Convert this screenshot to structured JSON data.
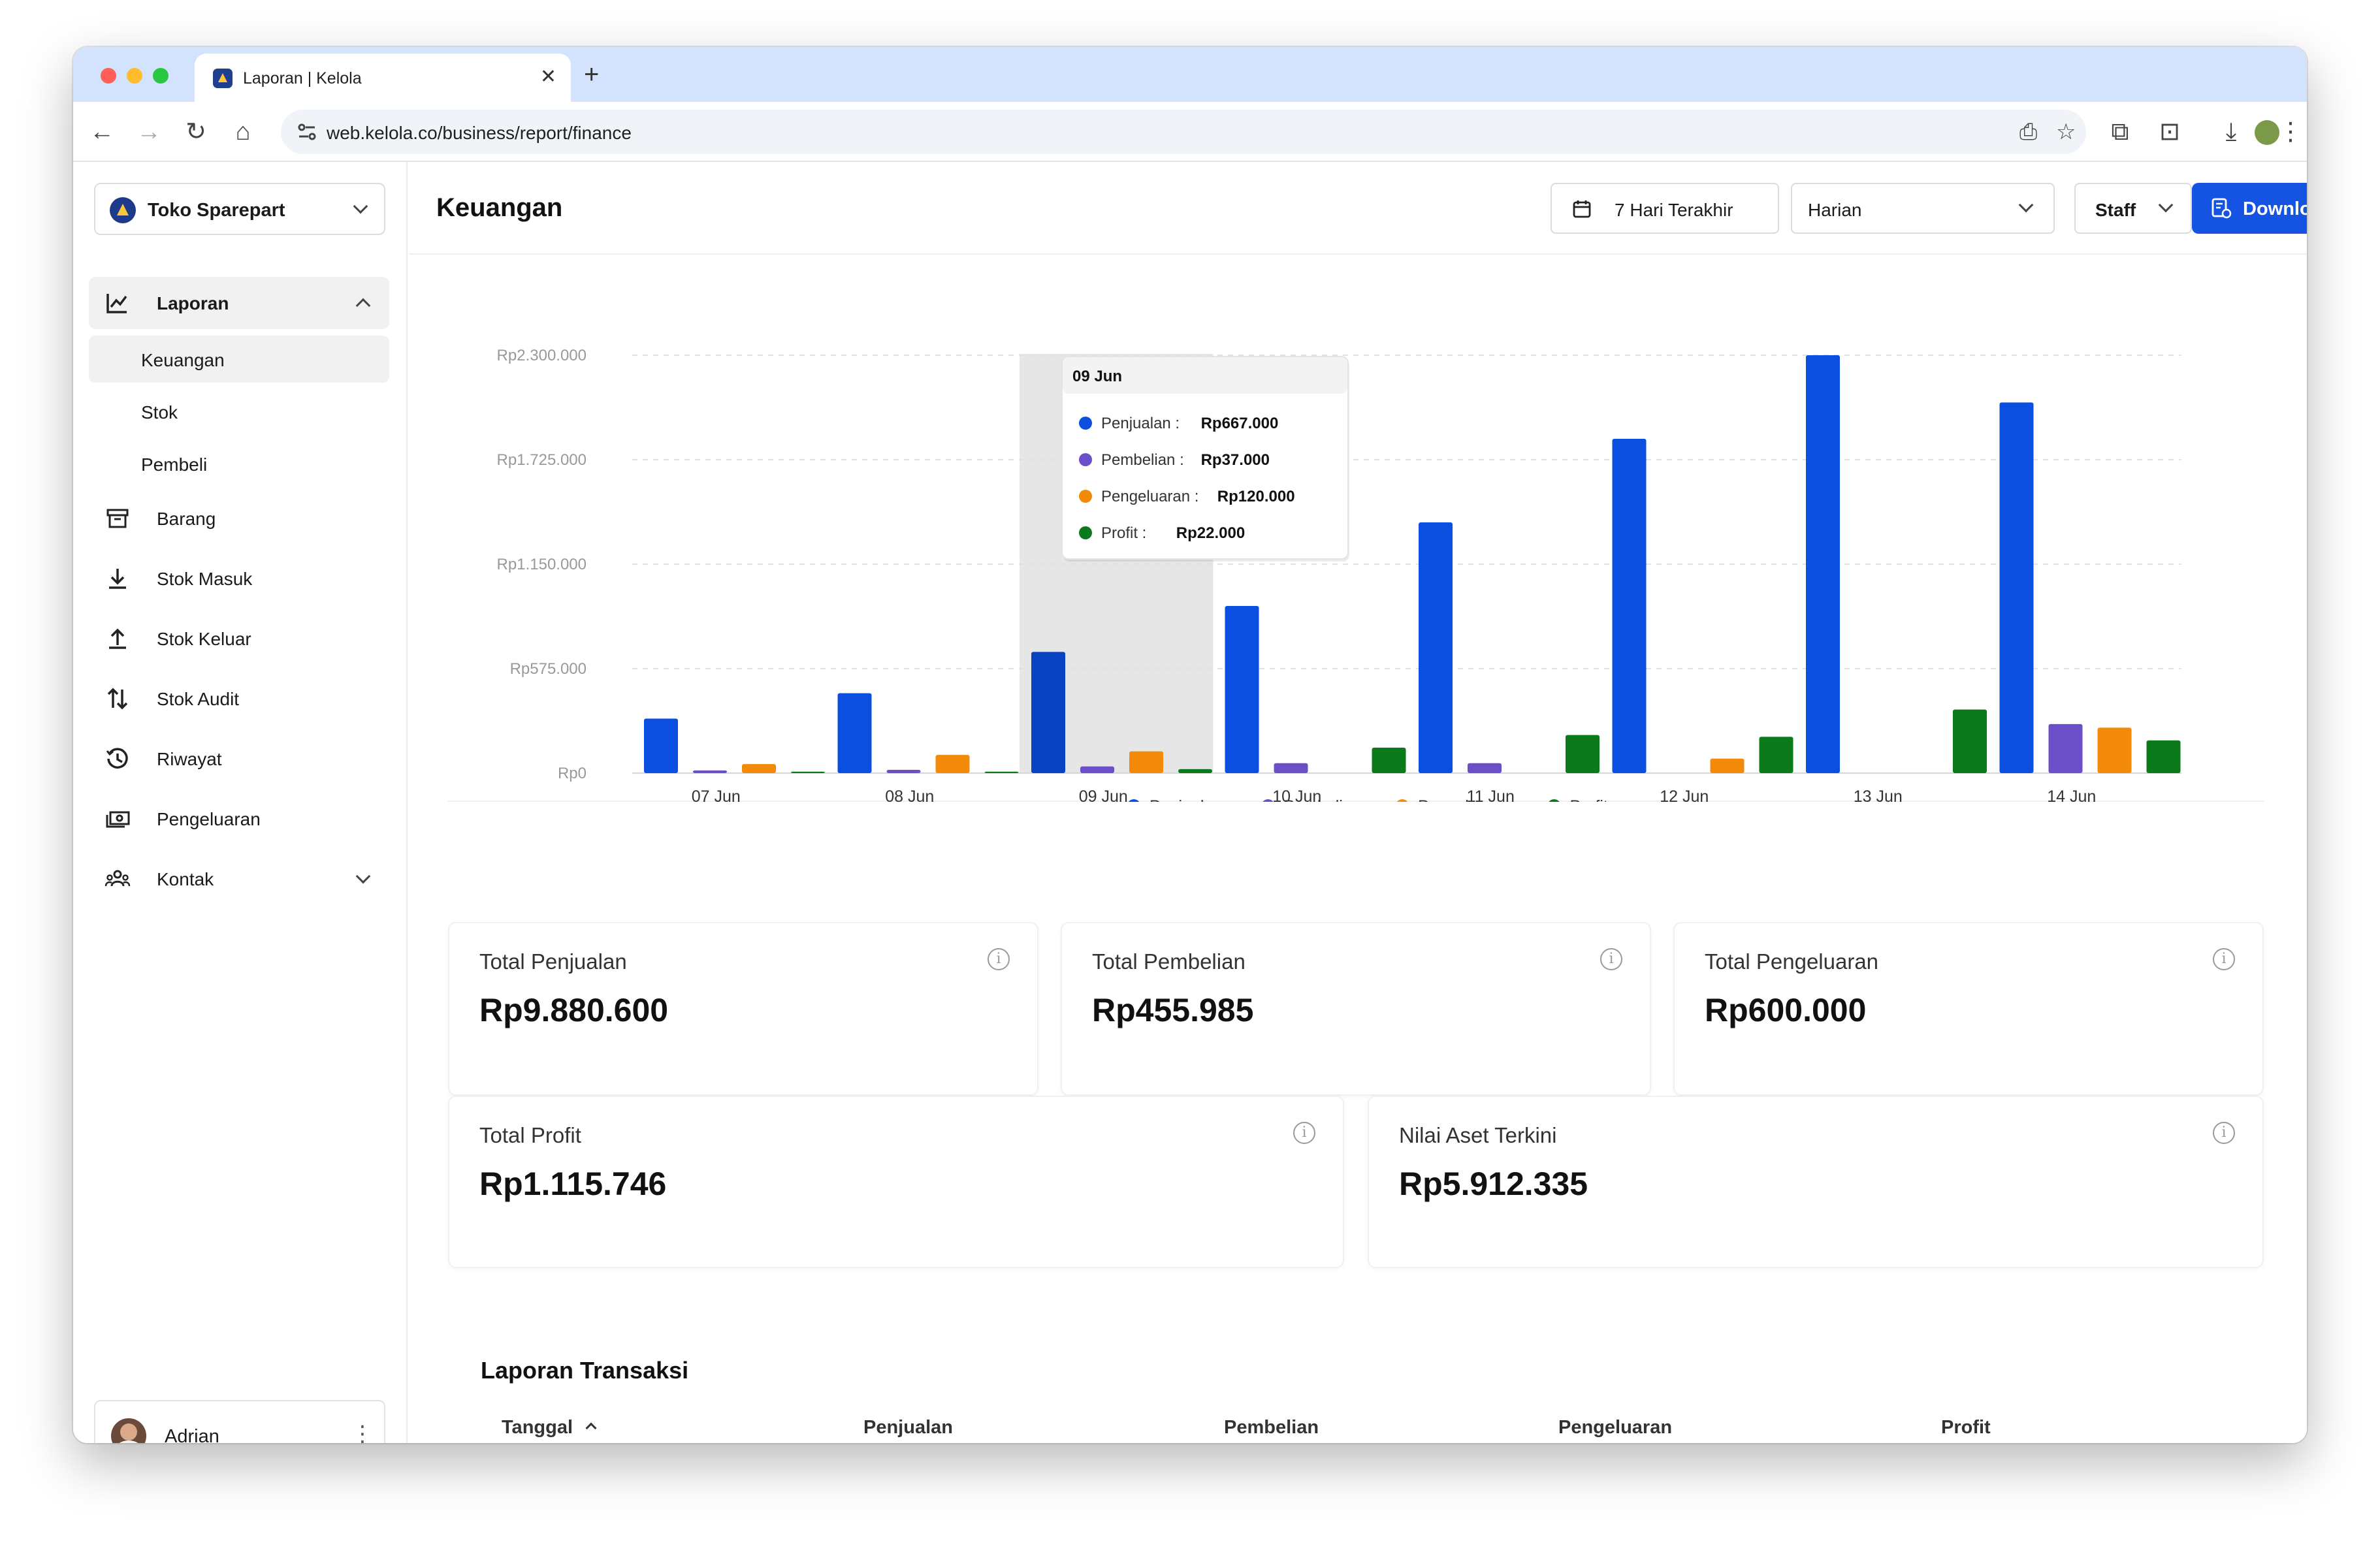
{
  "browser": {
    "tab_title": "Laporan | Kelola",
    "url": "web.kelola.co/business/report/finance"
  },
  "sidebar": {
    "store_name": "Toko Sparepart",
    "items": [
      {
        "label": "Laporan",
        "icon": "report-chart-icon"
      },
      {
        "label": "Barang",
        "icon": "box-icon"
      },
      {
        "label": "Stok Masuk",
        "icon": "download-arrow-icon"
      },
      {
        "label": "Stok Keluar",
        "icon": "upload-arrow-icon"
      },
      {
        "label": "Stok Audit",
        "icon": "swap-arrows-icon"
      },
      {
        "label": "Riwayat",
        "icon": "history-icon"
      },
      {
        "label": "Pengeluaran",
        "icon": "cash-icon"
      },
      {
        "label": "Kontak",
        "icon": "contacts-icon"
      }
    ],
    "sub_items": [
      "Keuangan",
      "Stok",
      "Pembeli"
    ],
    "user_name": "Adrian"
  },
  "header": {
    "title": "Keuangan",
    "date_range": "7 Hari Terakhir",
    "interval": "Harian",
    "staff": "Staff",
    "download": "Download"
  },
  "chart_data": {
    "type": "bar",
    "categories": [
      "07 Jun",
      "08 Jun",
      "09 Jun",
      "10 Jun",
      "11 Jun",
      "12 Jun",
      "13 Jun",
      "14 Jun"
    ],
    "y_ticks": [
      "Rp0",
      "Rp575.000",
      "Rp1.150.000",
      "Rp1.725.000",
      "Rp2.300.000"
    ],
    "ylim": [
      0,
      2300000
    ],
    "grid": true,
    "legend_position": "bottom",
    "series": [
      {
        "name": "Penjualan",
        "color": "#0b4fe0",
        "values": [
          300000,
          440000,
          667000,
          920000,
          1380000,
          1840000,
          2300000,
          2040000
        ]
      },
      {
        "name": "Pembelian",
        "color": "#6a4fc9",
        "values": [
          15000,
          18000,
          37000,
          55000,
          55000,
          0,
          0,
          270000
        ]
      },
      {
        "name": "Pengeluaran",
        "color": "#f48a0a",
        "values": [
          50000,
          100000,
          120000,
          0,
          0,
          80000,
          0,
          250000
        ]
      },
      {
        "name": "Profit",
        "color": "#0b7a1c",
        "values": [
          8000,
          8000,
          22000,
          140000,
          210000,
          200000,
          350000,
          180000
        ]
      }
    ],
    "tooltip": {
      "title": "09 Jun",
      "rows": [
        {
          "label": "Penjualan :",
          "value": "Rp667.000",
          "color": "#0b4fe0"
        },
        {
          "label": "Pembelian :",
          "value": "Rp37.000",
          "color": "#6a4fc9"
        },
        {
          "label": "Pengeluaran :",
          "value": "Rp120.000",
          "color": "#f48a0a"
        },
        {
          "label": "Profit :",
          "value": "Rp22.000",
          "color": "#0b7a1c"
        }
      ]
    }
  },
  "stats": [
    {
      "label": "Total Penjualan",
      "value": "Rp9.880.600"
    },
    {
      "label": "Total Pembelian",
      "value": "Rp455.985"
    },
    {
      "label": "Total Pengeluaran",
      "value": "Rp600.000"
    },
    {
      "label": "Total Profit",
      "value": "Rp1.115.746"
    },
    {
      "label": "Nilai Aset Terkini",
      "value": "Rp5.912.335"
    }
  ],
  "transactions": {
    "title": "Laporan Transaksi",
    "columns": [
      "Tanggal",
      "Penjualan",
      "Pembelian",
      "Pengeluaran",
      "Profit"
    ]
  }
}
